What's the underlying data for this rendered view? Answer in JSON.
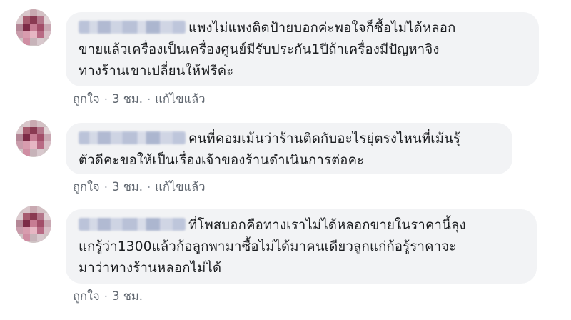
{
  "comments": [
    {
      "text_lines": [
        "แพงไม่แพงติดป้ายบอกค่ะพอใจก็ซื้อไม่ได้หลอก",
        "ขายแล้วเครื่องเป็นเครื่องศูนย์มีรับประกัน1ปีถ้าเครื่องมีปัญหาจิง",
        "ทางร้านเขาเปลี่ยนให้ฟรีค่ะ"
      ],
      "like": "ถูกใจ",
      "time": "3 ชม.",
      "edited": "แก้ไขแล้ว",
      "sep": "·"
    },
    {
      "text_lines": [
        "คนที่คอมเม้นว่าร้านติดกับอะไรยุ่ตรงไหนที่เม้นรุ้",
        "ตัวดีคะขอให้เป็นเรื่องเจ้าของร้านดำเนินการต่อคะ"
      ],
      "like": "ถูกใจ",
      "time": "3 ชม.",
      "edited": "แก้ไขแล้ว",
      "sep": "·"
    },
    {
      "text_lines": [
        "ที่โพสบอกคือทางเราไม่ได้หลอกขายในราคานี้ลุง",
        "แกรู้ว่า1300แล้วก้อลูกพามาซื้อไม่ได้มาคนเดียวลูกแก่ก้อรู้ราคาจะ",
        "มาว่าทางร้านหลอกไม่ได้"
      ],
      "like": "ถูกใจ",
      "time": "3 ชม.",
      "sep": "·"
    }
  ]
}
